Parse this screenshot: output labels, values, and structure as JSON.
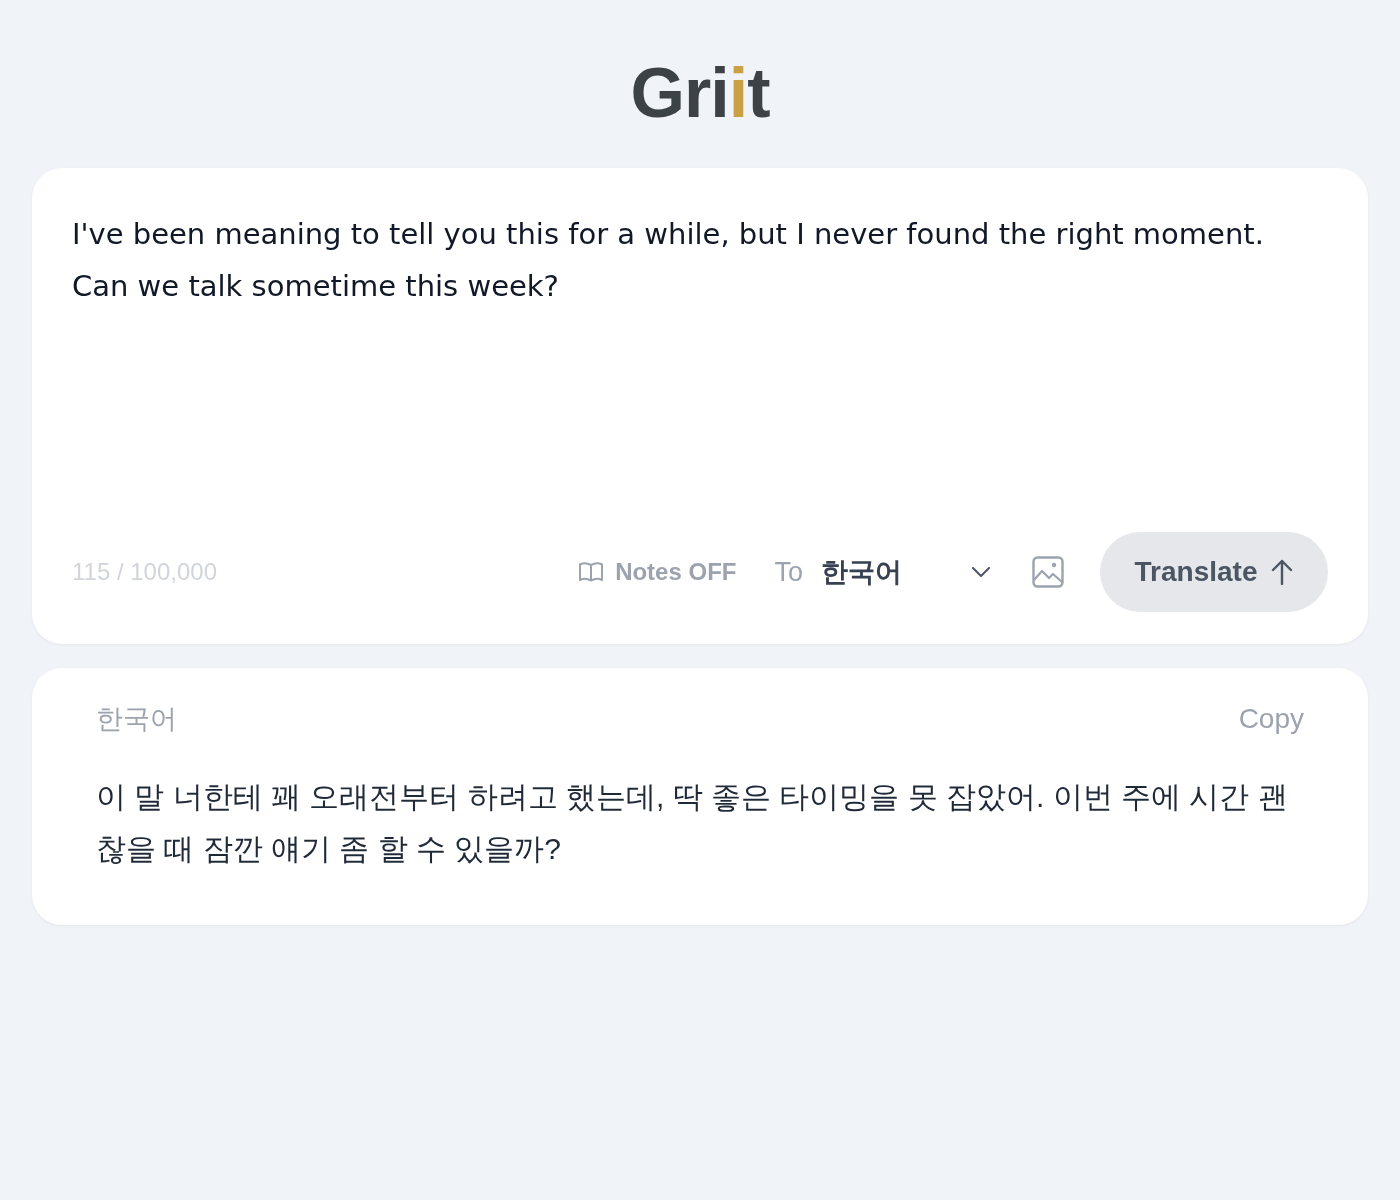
{
  "logo": {
    "parts": [
      {
        "text": "Gri",
        "accent": false
      },
      {
        "text": "i",
        "accent": true
      },
      {
        "text": "t",
        "accent": false
      }
    ]
  },
  "source": {
    "value": "I've been meaning to tell you this for a while, but I never found the right moment. Can we talk sometime this week?",
    "counter": "115 / 100,000"
  },
  "toolbar": {
    "notes": {
      "label": "Notes OFF"
    },
    "target_prefix": "To",
    "target_language": "한국어",
    "translate_label": "Translate"
  },
  "result": {
    "language": "한국어",
    "copy_label": "Copy",
    "text": "이 말 너한테 꽤 오래전부터 하려고 했는데, 딱 좋은 타이밍을 못 잡았어. 이번 주에 시간 괜찮을 때 잠깐 얘기 좀 할 수 있을까?"
  }
}
